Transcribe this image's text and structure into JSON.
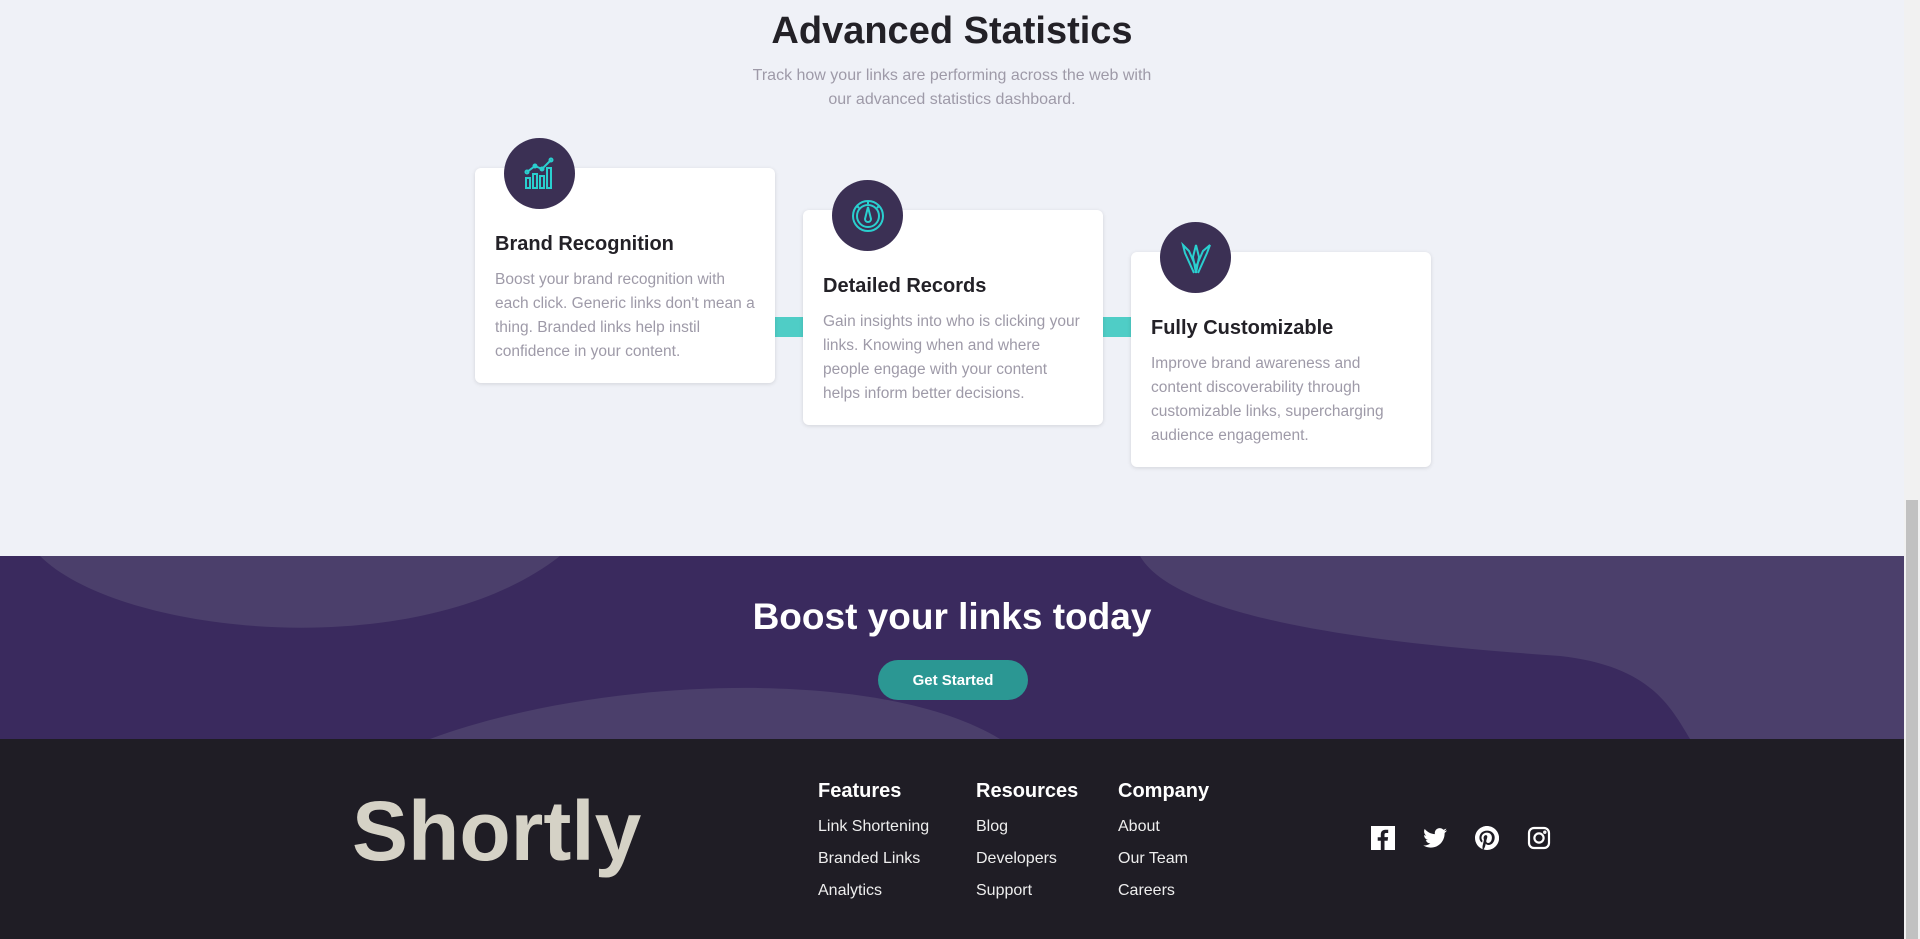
{
  "stats": {
    "title": "Advanced Statistics",
    "subtitle_line1": "Track how your links are performing across the web with",
    "subtitle_line2": "our advanced statistics dashboard.",
    "cards": [
      {
        "icon": "chart-icon",
        "title": "Brand Recognition",
        "text": "Boost your brand recognition with each click. Generic links don't mean a thing. Branded links help instil confidence in your content."
      },
      {
        "icon": "gauge-icon",
        "title": "Detailed Records",
        "text": "Gain insights into who is clicking your links. Knowing when and where people engage with your content helps inform better decisions."
      },
      {
        "icon": "brushes-icon",
        "title": "Fully Customizable",
        "text": "Improve brand awareness and content discoverability through customizable links, supercharging audience engagement."
      }
    ]
  },
  "boost": {
    "title": "Boost your links today",
    "cta_label": "Get Started"
  },
  "footer": {
    "logo": "Shortly",
    "columns": [
      {
        "title": "Features",
        "links": [
          "Link Shortening",
          "Branded Links",
          "Analytics"
        ]
      },
      {
        "title": "Resources",
        "links": [
          "Blog",
          "Developers",
          "Support"
        ]
      },
      {
        "title": "Company",
        "links": [
          "About",
          "Our Team",
          "Careers"
        ]
      }
    ],
    "socials": [
      "facebook-icon",
      "twitter-icon",
      "pinterest-icon",
      "instagram-icon"
    ]
  },
  "colors": {
    "accent_cyan": "#2acfcf",
    "dark_violet": "#3b3054",
    "cta_teal": "#2b9793",
    "footer_bg": "#1f1d25"
  }
}
